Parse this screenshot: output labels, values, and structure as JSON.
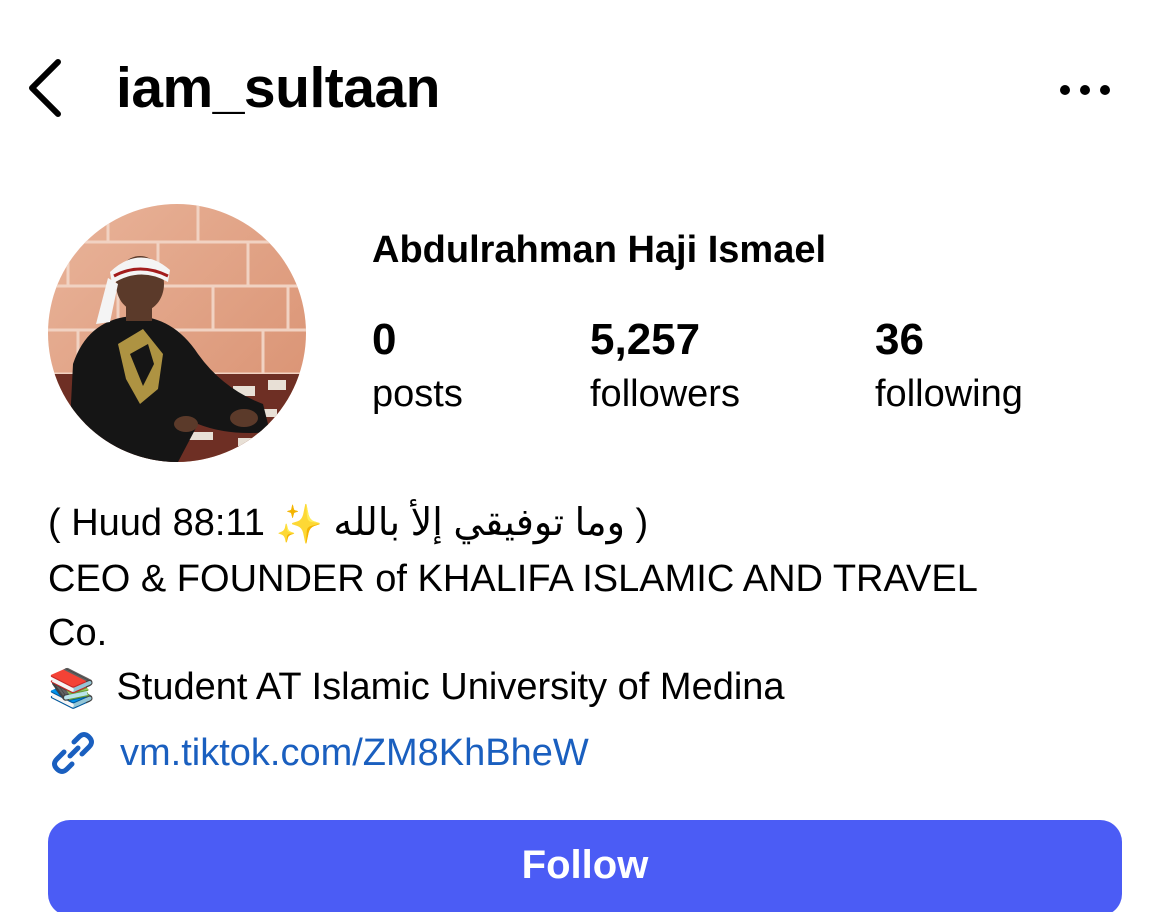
{
  "header": {
    "username": "iam_sultaan",
    "back_icon": "chevron-left-icon",
    "more_icon": "more-horizontal-icon"
  },
  "profile": {
    "full_name": "Abdulrahman Haji Ismael",
    "stats": {
      "posts_count": "0",
      "posts_label": "posts",
      "followers_count": "5,257",
      "followers_label": "followers",
      "following_count": "36",
      "following_label": "following"
    }
  },
  "bio": {
    "line1_prefix": "( Huud 88:11 ",
    "line1_emoji": "✨",
    "line1_arabic": " وما توفيقي إلأ بالله )",
    "line2": "CEO & FOUNDER of KHALIFA ISLAMIC AND TRAVEL",
    "line3": "Co.",
    "line4_emoji": "📚",
    "line4_text": "Student AT Islamic University of Medina",
    "link_icon": "link-icon",
    "link_text": "vm.tiktok.com/ZM8KhBheW"
  },
  "actions": {
    "follow_label": "Follow"
  },
  "colors": {
    "follow_button": "#4b5cf5",
    "link": "#1a5fbf"
  }
}
